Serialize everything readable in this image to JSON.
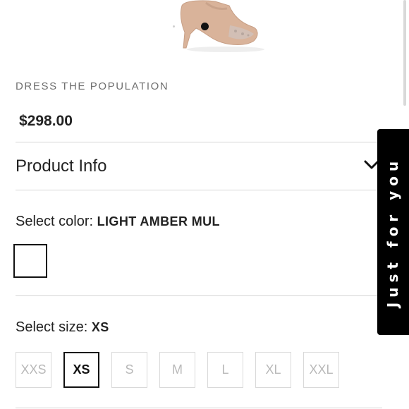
{
  "product": {
    "brand": "DRESS THE POPULATION",
    "price": "$298.00"
  },
  "product_info": {
    "label": "Product Info",
    "icon": "chevron-down-icon"
  },
  "color": {
    "label": "Select color:",
    "selected": "LIGHT AMBER MUL"
  },
  "size": {
    "label": "Select size:",
    "selected": "XS",
    "options": [
      "XXS",
      "XS",
      "S",
      "M",
      "L",
      "XL",
      "XXL"
    ]
  },
  "side_tab": {
    "label": "Just for you"
  },
  "colors": {
    "text": "#1f1f1f",
    "muted": "#6f6f6f",
    "disabled_size": "#b9b9b9",
    "divider": "#d6d6d6",
    "tab_bg": "#000000"
  }
}
